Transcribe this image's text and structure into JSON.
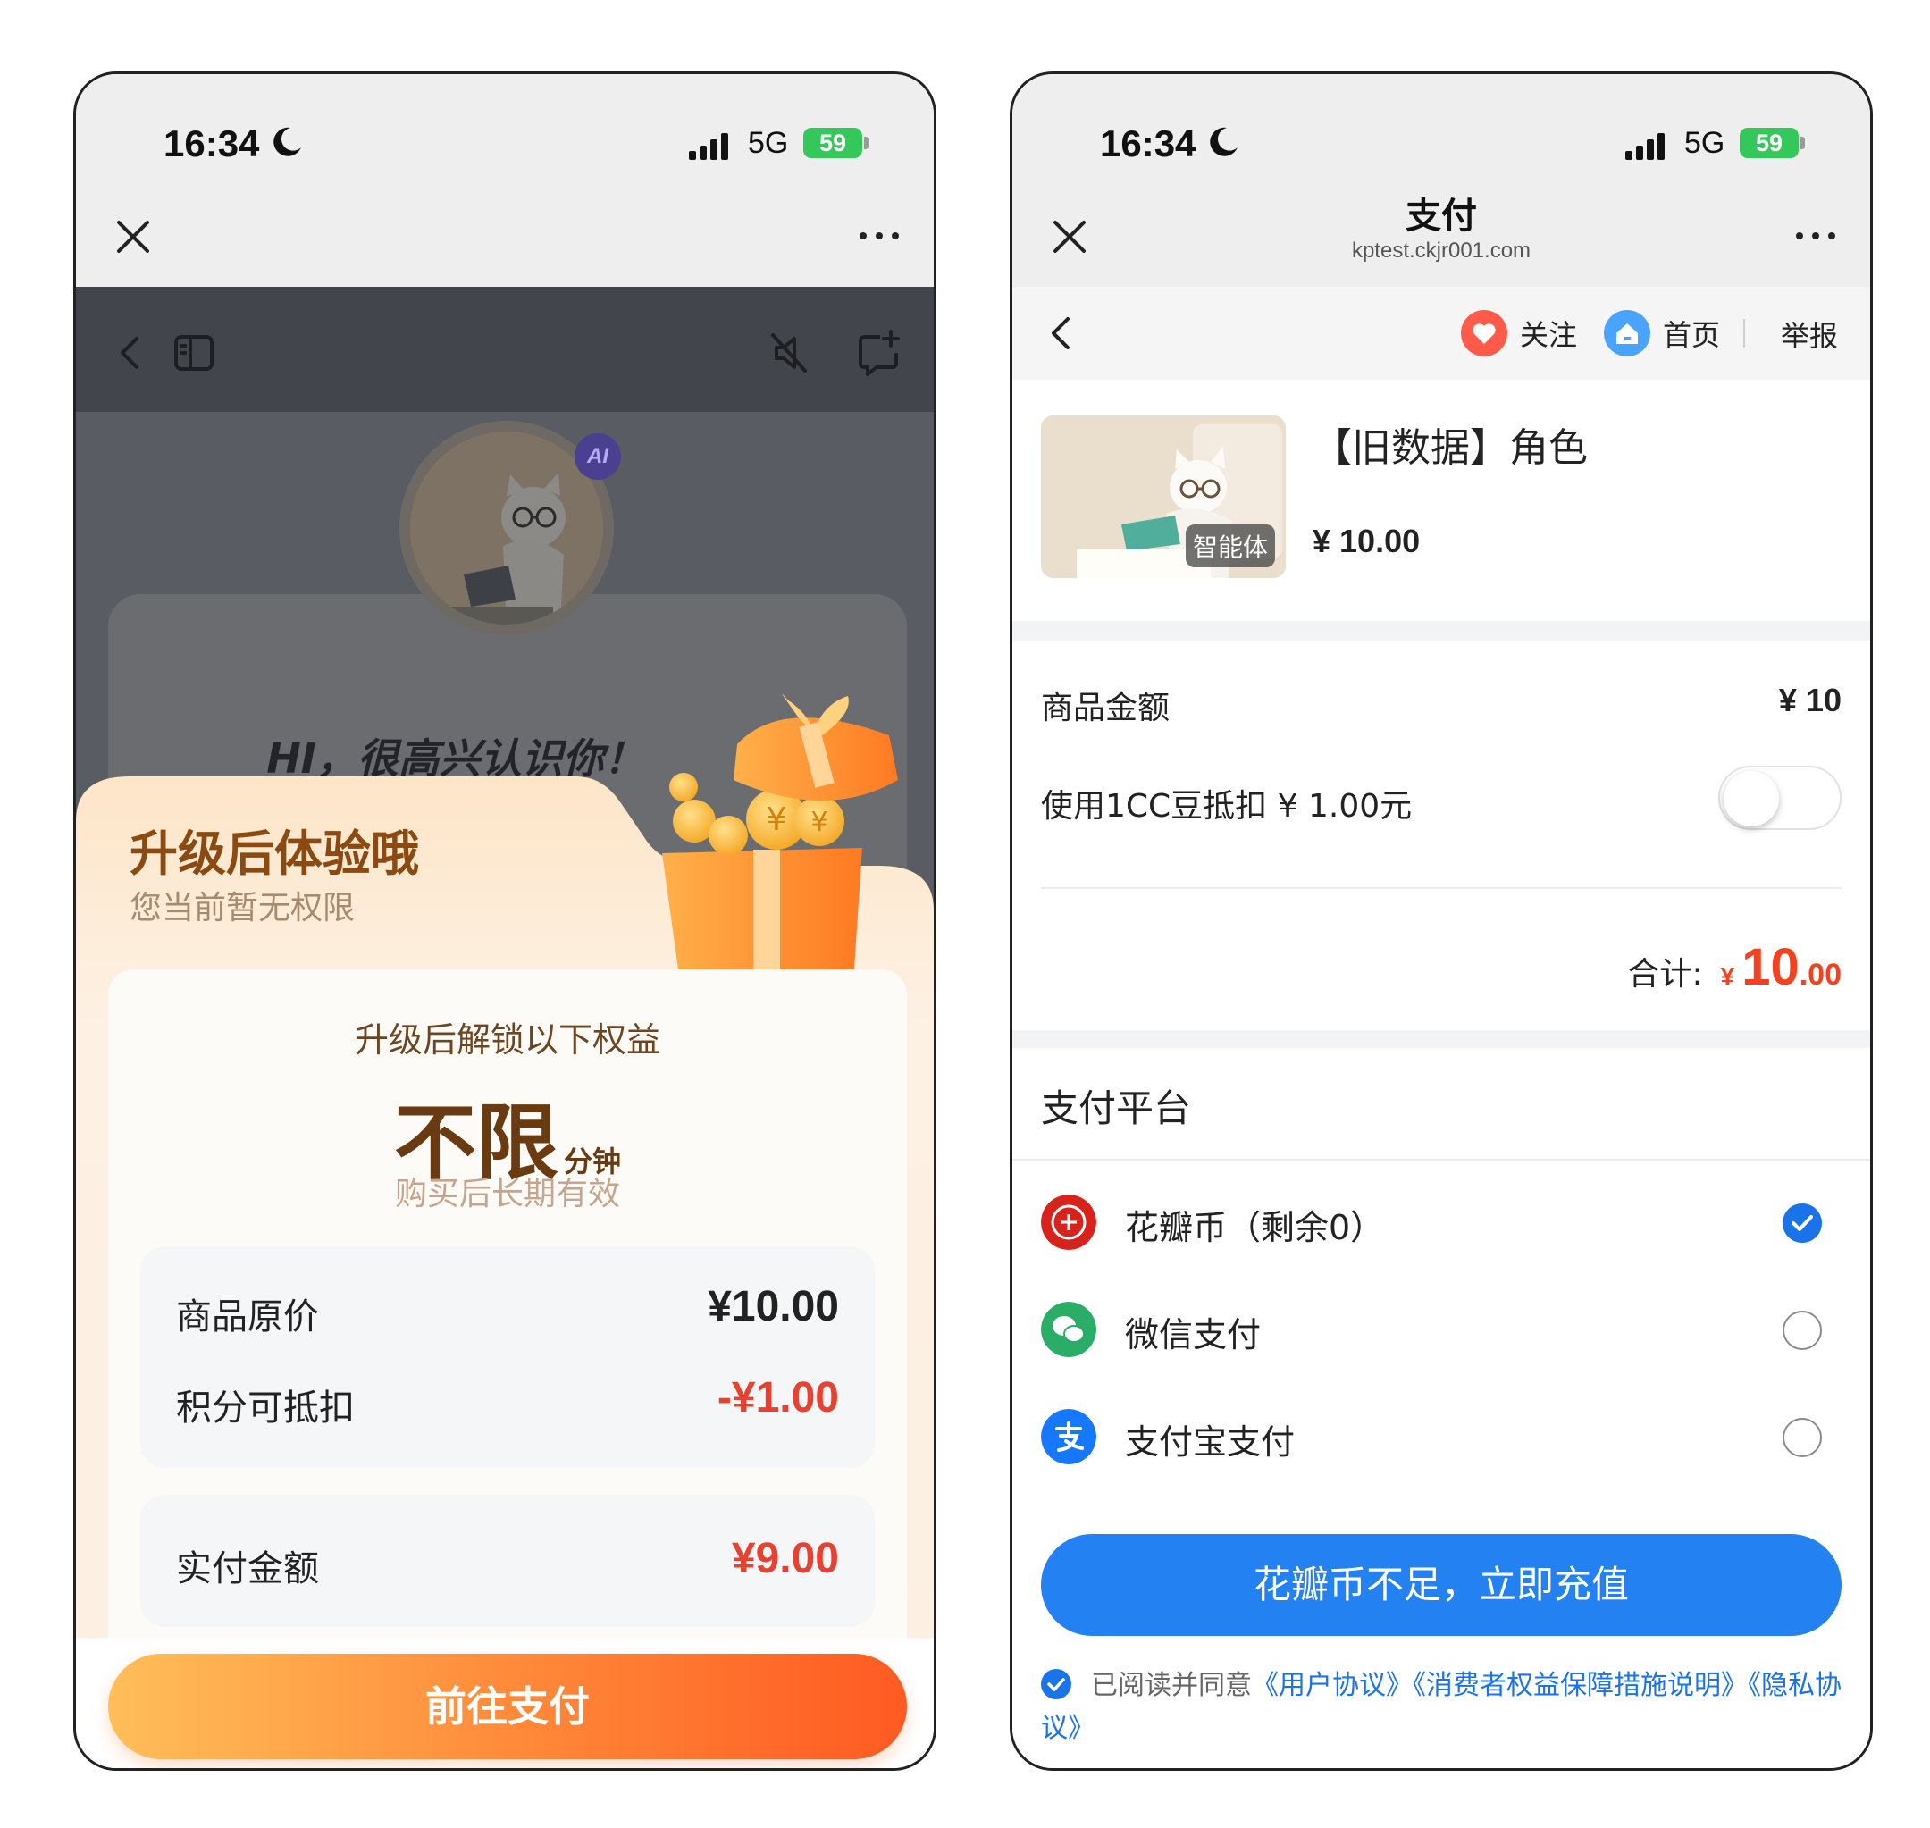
{
  "phone1": {
    "status": {
      "time": "16:34",
      "network": "5G",
      "battery": "59"
    },
    "greeting": "HI，很高兴认识你！",
    "ai_badge": "AI",
    "upgrade": {
      "title": "升级后体验哦",
      "subtitle": "您当前暂无权限"
    },
    "benefits": {
      "heading": "升级后解锁以下权益",
      "value": "不限",
      "unit": "分钟",
      "note": "购买后长期有效"
    },
    "prices": [
      {
        "label": "商品原价",
        "value": "¥10.00",
        "color": "#222222"
      },
      {
        "label": "积分可抵扣",
        "value": "-¥1.00",
        "color": "#e8412f"
      }
    ],
    "actual": {
      "label": "实付金额",
      "value": "¥9.00",
      "color": "#e8412f"
    },
    "pay_button": "前往支付"
  },
  "phone2": {
    "status": {
      "time": "16:34",
      "network": "5G",
      "battery": "59"
    },
    "nav": {
      "title": "支付",
      "subtitle": "kptest.ckjr001.com"
    },
    "subheader": {
      "follow": "关注",
      "home": "首页",
      "report": "举报"
    },
    "product": {
      "name": "【旧数据】角色",
      "tag": "智能体",
      "price": "¥ 10.00"
    },
    "amount": {
      "label": "商品金额",
      "value": "¥ 10",
      "deduct_label": "使用1CC豆抵扣 ¥ 1.00元",
      "deduct_enabled": false,
      "total_label": "合计:",
      "total_currency": "¥",
      "total_int": "10",
      "total_dec": ".00"
    },
    "platform": {
      "title": "支付平台",
      "options": [
        {
          "label": "花瓣币（剩余0）",
          "icon": "petal-coin-icon",
          "selected": true
        },
        {
          "label": "微信支付",
          "icon": "wechat-pay-icon",
          "selected": false
        },
        {
          "label": "支付宝支付",
          "icon": "alipay-icon",
          "selected": false
        }
      ]
    },
    "recharge_button": "花瓣币不足，立即充值",
    "agreement": {
      "prefix": "已阅读并同意",
      "links": [
        "《用户协议》",
        "《消费者权益保障措施说明》",
        "《隐私协议》"
      ]
    },
    "colors": {
      "accent": "#2381f2",
      "total": "#f5411f"
    }
  }
}
